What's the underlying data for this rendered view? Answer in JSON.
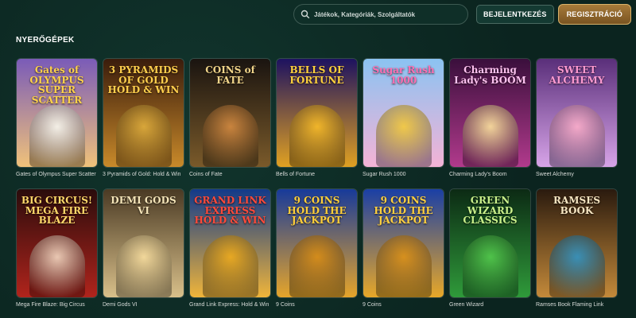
{
  "header": {
    "search_placeholder": "Játékok, Kategóriák, Szolgáltatók",
    "login_label": "BEJELENTKEZÉS",
    "register_label": "REGISZTRÁCIÓ"
  },
  "section": {
    "title": "NYERŐGÉPEK"
  },
  "games": [
    {
      "name": "Gates of Olympus Super Scatter",
      "logo": "Gates of OLYMPUS SUPER SCATTER",
      "bg": "#7a5bb8",
      "bg2": "#f0c27a",
      "logo_color": "#ffd24a",
      "figure_color": "#f3efe6"
    },
    {
      "name": "3 Pyramids of Gold: Hold & Win",
      "logo": "3 PYRAMIDS OF GOLD HOLD & WIN",
      "bg": "#3a1c0c",
      "bg2": "#c98a2a",
      "logo_color": "#ffcf4d",
      "figure_color": "#d8a63a"
    },
    {
      "name": "Coins of Fate",
      "logo": "COINS of FATE",
      "bg": "#1a1410",
      "bg2": "#7a5a2a",
      "logo_color": "#f1d58a",
      "figure_color": "#c9843e"
    },
    {
      "name": "Bells of Fortune",
      "logo": "BELLS OF FORTUNE",
      "bg": "#1d1260",
      "bg2": "#e0a122",
      "logo_color": "#ffd13d",
      "figure_color": "#f0b52a"
    },
    {
      "name": "Sugar Rush 1000",
      "logo": "Sugar Rush 1000",
      "bg": "#8bc3f2",
      "bg2": "#f4b3d6",
      "logo_color": "#ff6fb3",
      "figure_color": "#f0c84a"
    },
    {
      "name": "Charming Lady's Boom",
      "logo": "Charming Lady's BOOM",
      "bg": "#3a0f3c",
      "bg2": "#b13a8c",
      "logo_color": "#ffc2f0",
      "figure_color": "#f2d39a"
    },
    {
      "name": "Sweet Alchemy",
      "logo": "SWEET ALCHEMY",
      "bg": "#5a2f7a",
      "bg2": "#d7a4e8",
      "logo_color": "#ff9ad1",
      "figure_color": "#f4a9c9"
    },
    {
      "name": "Mega Fire Blaze: Big Circus",
      "logo": "BIG CIRCUS! MEGA FIRE BLAZE",
      "bg": "#2a0c0c",
      "bg2": "#b0241c",
      "logo_color": "#ffd86a",
      "figure_color": "#e9c7b2"
    },
    {
      "name": "Demi Gods VI",
      "logo": "DEMI GODS VI",
      "bg": "#4a3a24",
      "bg2": "#d9c08a",
      "logo_color": "#f4e4b8",
      "figure_color": "#f1d79a"
    },
    {
      "name": "Grand Link Express: Hold & Win",
      "logo": "GRAND LINK EXPRESS HOLD & WIN",
      "bg": "#123a8a",
      "bg2": "#f0b53a",
      "logo_color": "#ff4a3a",
      "figure_color": "#e7a823"
    },
    {
      "name": "9 Coins",
      "logo": "9 COINS HOLD THE JACKPOT",
      "bg": "#173a9a",
      "bg2": "#e6a52a",
      "logo_color": "#ffcf3a",
      "figure_color": "#d38c1c"
    },
    {
      "name": "9 Coins",
      "logo": "9 COINS HOLD THE JACKPOT",
      "bg": "#1a3fa5",
      "bg2": "#e8a828",
      "logo_color": "#ffd040",
      "figure_color": "#d6901e"
    },
    {
      "name": "Green Wizard",
      "logo": "GREEN WIZARD CLASSICS",
      "bg": "#0c2a14",
      "bg2": "#2f9a3a",
      "logo_color": "#c9f08a",
      "figure_color": "#4fc24a"
    },
    {
      "name": "Ramses Book Flaming Link",
      "logo": "RAMSES BOOK",
      "bg": "#2a1a0e",
      "bg2": "#c48a3a",
      "logo_color": "#f7e6c2",
      "figure_color": "#3a8fb5"
    }
  ]
}
